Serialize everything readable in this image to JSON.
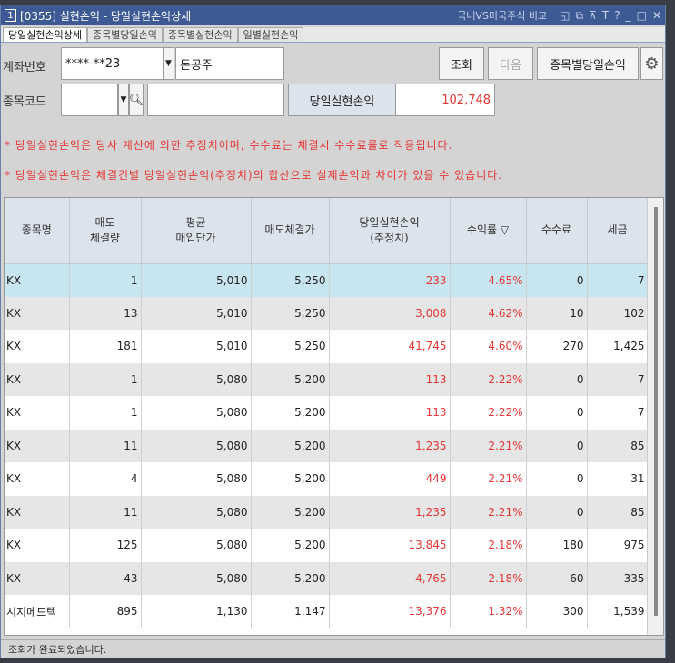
{
  "window": {
    "number": "1",
    "title": "[0355] 실현손익 - 당일실현손익상세",
    "compare": "국내VS미국주식 비교",
    "icons": [
      "restore-icon",
      "copy-icon",
      "pin-icon",
      "text-icon",
      "help-icon",
      "minimize-icon",
      "maximize-icon",
      "close-icon"
    ]
  },
  "tabs": [
    {
      "label": "당일실현손익상세",
      "active": true
    },
    {
      "label": "종목별당일손익"
    },
    {
      "label": "종목별실현손익"
    },
    {
      "label": "일별실현손익"
    }
  ],
  "form": {
    "account_label": "계좌번호",
    "account_value": "****-**23",
    "account_name": "돈공주",
    "code_label": "종목코드",
    "code_value": "",
    "code_name": "",
    "search_btn": "조회",
    "next_btn": "다음",
    "by_stock_btn": "종목별당일손익",
    "pl_label": "당일실현손익",
    "pl_value": "102,748"
  },
  "notes": [
    "* 당일실현손익은 당사 계산에 의한 추정치이며, 수수료는 체결시 수수료률로 적용됩니다.",
    "* 당일실현손익은 체결건별 당일실현손익(추정치)의 합산으로 실제손익과 차이가 있을 수 있습니다."
  ],
  "table": {
    "headers": [
      [
        "종목명"
      ],
      [
        "매도",
        "체결량"
      ],
      [
        "평균",
        "매입단가"
      ],
      [
        "매도체결가"
      ],
      [
        "당일실현손익",
        "(추정치)"
      ],
      [
        "수익률 ▽"
      ],
      [
        "수수료"
      ],
      [
        "세금"
      ]
    ],
    "rows": [
      [
        "KX",
        "1",
        "5,010",
        "5,250",
        "233",
        "4.65%",
        "0",
        "7"
      ],
      [
        "KX",
        "13",
        "5,010",
        "5,250",
        "3,008",
        "4.62%",
        "10",
        "102"
      ],
      [
        "KX",
        "181",
        "5,010",
        "5,250",
        "41,745",
        "4.60%",
        "270",
        "1,425"
      ],
      [
        "KX",
        "1",
        "5,080",
        "5,200",
        "113",
        "2.22%",
        "0",
        "7"
      ],
      [
        "KX",
        "1",
        "5,080",
        "5,200",
        "113",
        "2.22%",
        "0",
        "7"
      ],
      [
        "KX",
        "11",
        "5,080",
        "5,200",
        "1,235",
        "2.21%",
        "0",
        "85"
      ],
      [
        "KX",
        "4",
        "5,080",
        "5,200",
        "449",
        "2.21%",
        "0",
        "31"
      ],
      [
        "KX",
        "11",
        "5,080",
        "5,200",
        "1,235",
        "2.21%",
        "0",
        "85"
      ],
      [
        "KX",
        "125",
        "5,080",
        "5,200",
        "13,845",
        "2.18%",
        "180",
        "975"
      ],
      [
        "KX",
        "43",
        "5,080",
        "5,200",
        "4,765",
        "2.18%",
        "60",
        "335"
      ],
      [
        "시지메드텍",
        "895",
        "1,130",
        "1,147",
        "13,376",
        "1.32%",
        "300",
        "1,539"
      ]
    ]
  },
  "status": "조회가 완료되었습니다.",
  "colors": {
    "title_bar": "#3d5a94",
    "profit_red": "#e53535",
    "selected_row": "#c8e6f0"
  }
}
